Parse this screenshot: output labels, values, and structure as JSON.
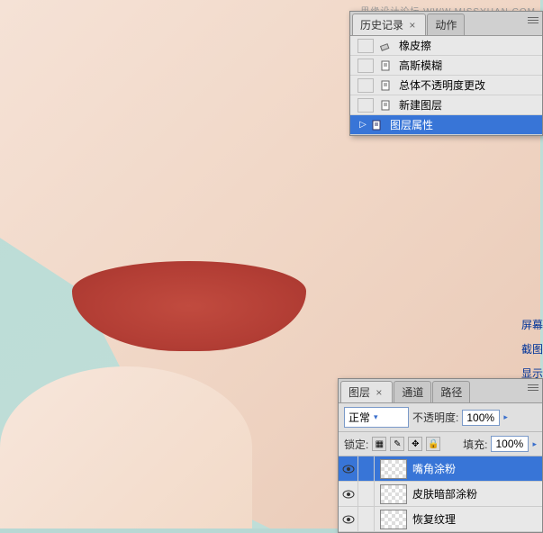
{
  "watermark": "思缘设计论坛 WWW.MISSYUAN.COM",
  "history_panel": {
    "tabs": [
      {
        "label": "历史记录",
        "active": true
      },
      {
        "label": "动作",
        "active": false
      }
    ],
    "items": [
      {
        "icon": "eraser",
        "label": "橡皮擦"
      },
      {
        "icon": "page",
        "label": "高斯模糊"
      },
      {
        "icon": "page",
        "label": "总体不透明度更改"
      },
      {
        "icon": "page",
        "label": "新建图层"
      },
      {
        "icon": "page",
        "label": "图层属性",
        "selected": true,
        "marker": true
      }
    ]
  },
  "side_labels": [
    "屏幕",
    "截图",
    "显示"
  ],
  "layers_panel": {
    "tabs": [
      {
        "label": "图层",
        "active": true
      },
      {
        "label": "通道",
        "active": false
      },
      {
        "label": "路径",
        "active": false
      }
    ],
    "blend_mode": "正常",
    "opacity_label": "不透明度:",
    "opacity_value": "100%",
    "lock_label": "锁定:",
    "fill_label": "填充:",
    "fill_value": "100%",
    "layers": [
      {
        "name": "嘴角涂粉",
        "selected": true
      },
      {
        "name": "皮肤暗部涂粉",
        "selected": false
      },
      {
        "name": "恢复纹理",
        "selected": false
      }
    ]
  }
}
